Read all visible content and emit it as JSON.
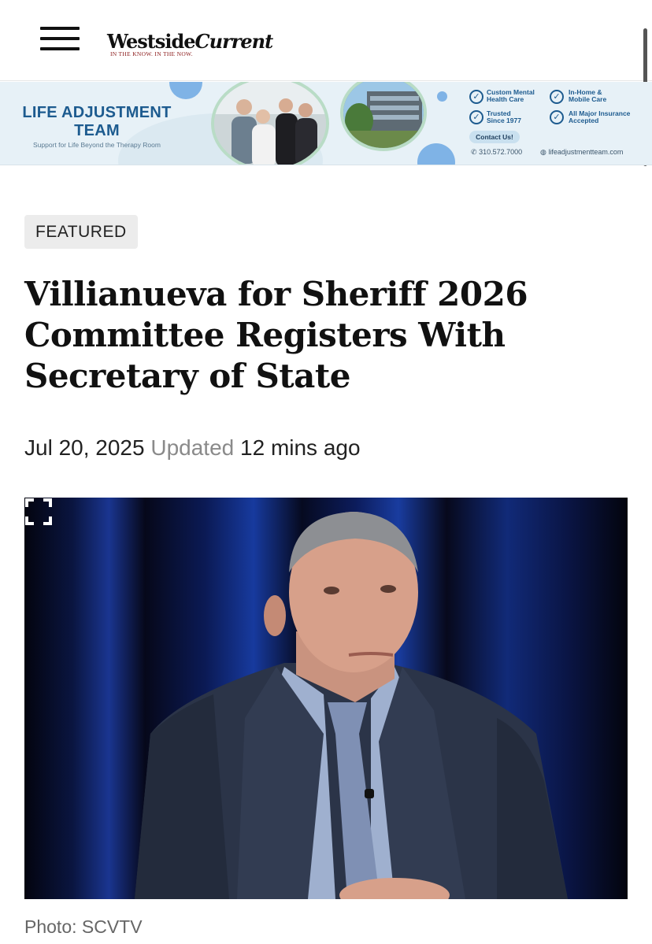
{
  "header": {
    "logo_main_a": "Westside",
    "logo_main_b": "Current",
    "logo_tagline": "IN THE KNOW. IN THE NOW."
  },
  "ad": {
    "title": "LIFE ADJUSTMENT TEAM",
    "subtitle": "Support for Life Beyond the Therapy Room",
    "features": [
      "Custom Mental Health Care",
      "In-Home & Mobile Care",
      "Trusted Since 1977",
      "All Major Insurance Accepted"
    ],
    "contact_label": "Contact Us!",
    "phone": "310.572.7000",
    "website": "lifeadjustmentteam.com"
  },
  "article": {
    "badge": "FEATURED",
    "headline": "Villianueva for Sheriff 2026 Committee Registers With Secretary of State",
    "date": "Jul 20, 2025",
    "updated_label": "Updated",
    "updated_value": "12 mins ago",
    "photo_caption": "Photo: SCVTV"
  }
}
